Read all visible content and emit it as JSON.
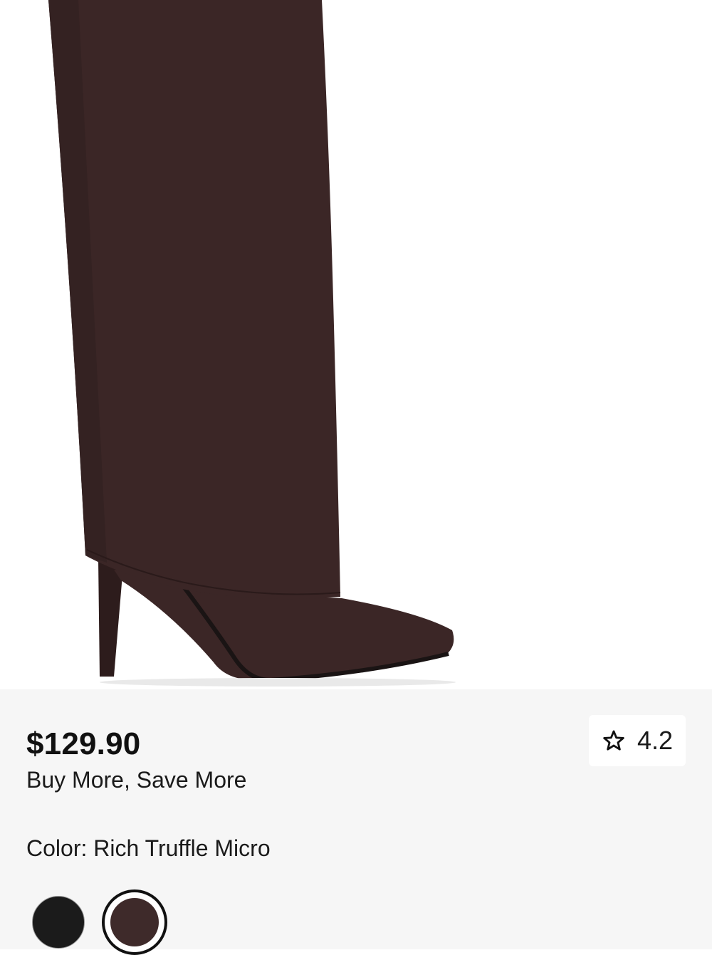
{
  "product": {
    "image_alt": "Knee-high foldover pointed-toe stiletto boot",
    "colors": {
      "boot": "#3b2626",
      "boot_shadow": "#2d1c1c",
      "sole": "#1a1414",
      "background": "#ffffff",
      "panel": "#f6f6f6"
    }
  },
  "pricing": {
    "price": "$129.90",
    "promo": "Buy More, Save More"
  },
  "rating": {
    "icon": "star-outline-icon",
    "value": "4.2"
  },
  "color_selector": {
    "label": "Color: Rich Truffle Micro",
    "swatches": [
      {
        "name": "Black",
        "hex": "#1b1b1b",
        "selected": false
      },
      {
        "name": "Rich Truffle Micro",
        "hex": "#3e2a2a",
        "selected": true
      }
    ]
  }
}
